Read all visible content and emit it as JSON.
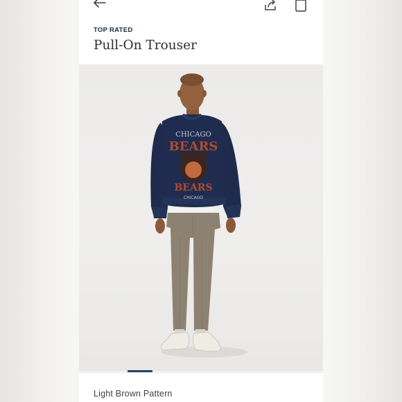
{
  "header": {
    "back_icon": "arrow-left-icon",
    "share_icon": "share-icon",
    "bag_icon": "shopping-bag-icon"
  },
  "product": {
    "badge": "TOP RATED",
    "title": "Pull-On Trouser",
    "color": "Light Brown Pattern"
  },
  "sweatshirt_graphic": {
    "line1": "CHICAGO",
    "line2": "BEARS",
    "line3": "BEARS",
    "line4": "CHICAGO"
  },
  "gallery": {
    "active_index": 1
  },
  "colors": {
    "accent": "#2e4466",
    "text": "#2a2f36",
    "sweatshirt": "#1e2b4d",
    "graphic": "#b24a2c",
    "trousers": "#8d8272"
  }
}
